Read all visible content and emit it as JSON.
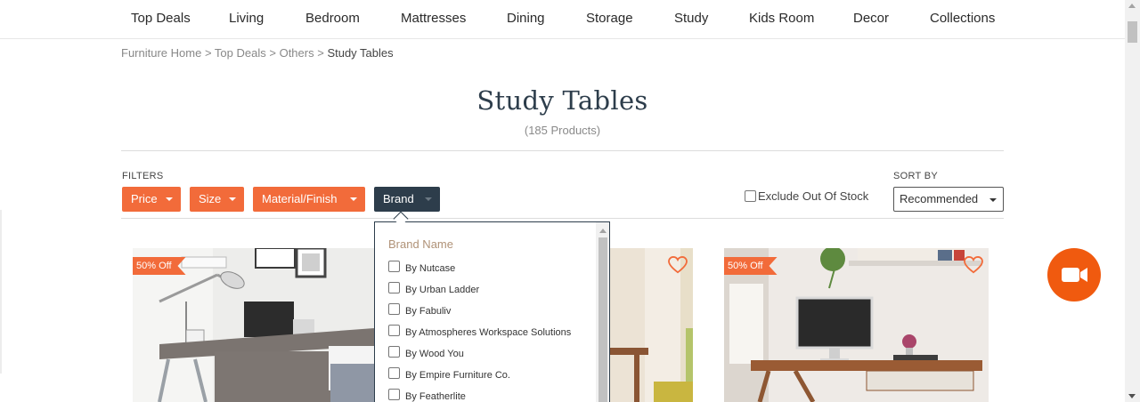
{
  "nav": {
    "items": [
      "Top Deals",
      "Living",
      "Bedroom",
      "Mattresses",
      "Dining",
      "Storage",
      "Study",
      "Kids Room",
      "Decor",
      "Collections"
    ]
  },
  "breadcrumb": {
    "items": [
      "Furniture Home",
      "Top Deals",
      "Others"
    ],
    "separator": ">",
    "current": "Study Tables"
  },
  "page": {
    "title": "Study Tables",
    "count": "(185 Products)"
  },
  "filters": {
    "label": "FILTERS",
    "buttons": [
      "Price",
      "Size",
      "Material/Finish",
      "Brand"
    ],
    "active": "Brand",
    "exclude_out_of_stock": "Exclude Out Of Stock"
  },
  "sort": {
    "label": "SORT BY",
    "selected": "Recommended"
  },
  "brand_dropdown": {
    "title": "Brand Name",
    "options": [
      "By Nutcase",
      "By Urban Ladder",
      "By Fabuliv",
      "By Atmospheres Workspace Solutions",
      "By Wood You",
      "By Empire Furniture Co.",
      "By Featherlite"
    ]
  },
  "products": [
    {
      "badge": "50% Off"
    },
    {
      "badge": ""
    },
    {
      "badge": "50% Off"
    }
  ],
  "colors": {
    "accent": "#f26b3a",
    "dark": "#2d3d4b",
    "fab": "#f05a0f"
  },
  "icons": {
    "wishlist": "heart-outline-icon",
    "video": "video-camera-icon"
  }
}
